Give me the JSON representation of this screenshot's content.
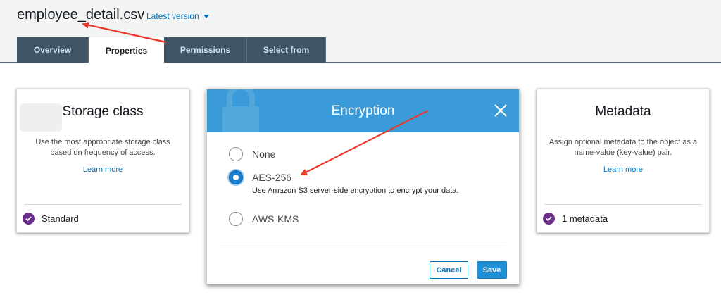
{
  "header": {
    "filename": "employee_detail.csv",
    "version_label": "Latest version"
  },
  "tabs": [
    {
      "label": "Overview",
      "active": false
    },
    {
      "label": "Properties",
      "active": true
    },
    {
      "label": "Permissions",
      "active": false
    },
    {
      "label": "Select from",
      "active": false
    }
  ],
  "storage_card": {
    "title": "Storage class",
    "description": "Use the most appropriate storage class based on frequency of access.",
    "link": "Learn more",
    "value": "Standard"
  },
  "encryption_dialog": {
    "title": "Encryption",
    "options": [
      {
        "label": "None",
        "selected": false
      },
      {
        "label": "AES-256",
        "selected": true,
        "description": "Use Amazon S3 server-side encryption to encrypt your data."
      },
      {
        "label": "AWS-KMS",
        "selected": false
      }
    ],
    "cancel_label": "Cancel",
    "save_label": "Save"
  },
  "metadata_card": {
    "title": "Metadata",
    "description": "Assign optional metadata to the object as a name-value (key-value) pair.",
    "link": "Learn more",
    "value": "1 metadata"
  },
  "colors": {
    "header_bg": "#f2f3f3",
    "tab_bg": "#415466",
    "dialog_header": "#3b9bd8",
    "link": "#0073bb",
    "check": "#6b2d8a",
    "annotation_arrow": "#e8392b"
  }
}
